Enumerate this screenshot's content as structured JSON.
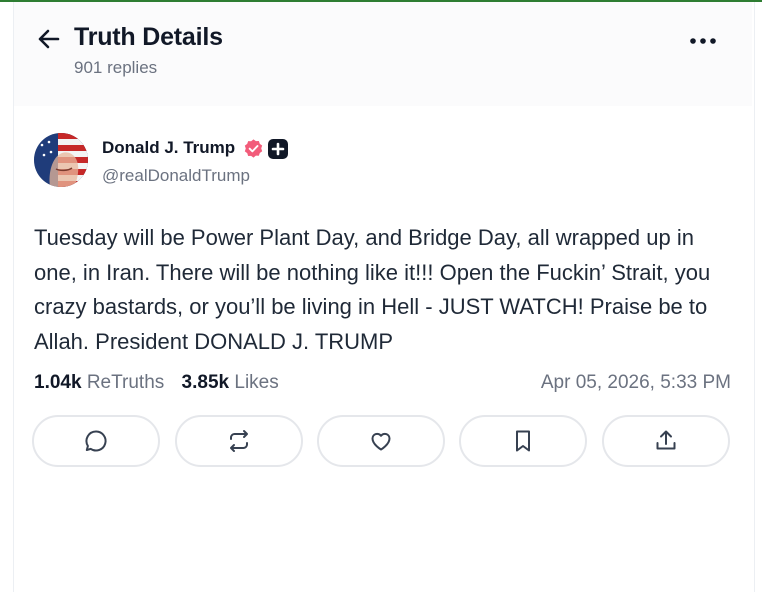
{
  "header": {
    "title": "Truth Details",
    "replies": "901 replies",
    "back_icon": "arrow-left-icon",
    "more_icon": "more-horizontal-icon"
  },
  "author": {
    "name": "Donald J. Trump",
    "handle": "@realDonaldTrump",
    "verified_icon": "verified-badge-icon",
    "badge_icon": "plus-badge-icon"
  },
  "post": {
    "text": "Tuesday will be Power Plant Day, and Bridge Day, all wrapped up in one, in Iran. There will be nothing like it!!! Open the Fuckin’ Strait, you crazy bastards, or you’ll be living in Hell - JUST WATCH! Praise be to Allah. President DONALD J. TRUMP",
    "retruths_count": "1.04k",
    "retruths_label": "ReTruths",
    "likes_count": "3.85k",
    "likes_label": "Likes",
    "timestamp": "Apr 05, 2026, 5:33 PM"
  },
  "actions": [
    {
      "icon": "reply-icon"
    },
    {
      "icon": "retruth-icon"
    },
    {
      "icon": "like-icon"
    },
    {
      "icon": "bookmark-icon"
    },
    {
      "icon": "share-icon"
    }
  ],
  "colors": {
    "verified": "#f25c7a",
    "text": "#111827",
    "muted": "#6b7280",
    "border": "#e5e7eb"
  }
}
